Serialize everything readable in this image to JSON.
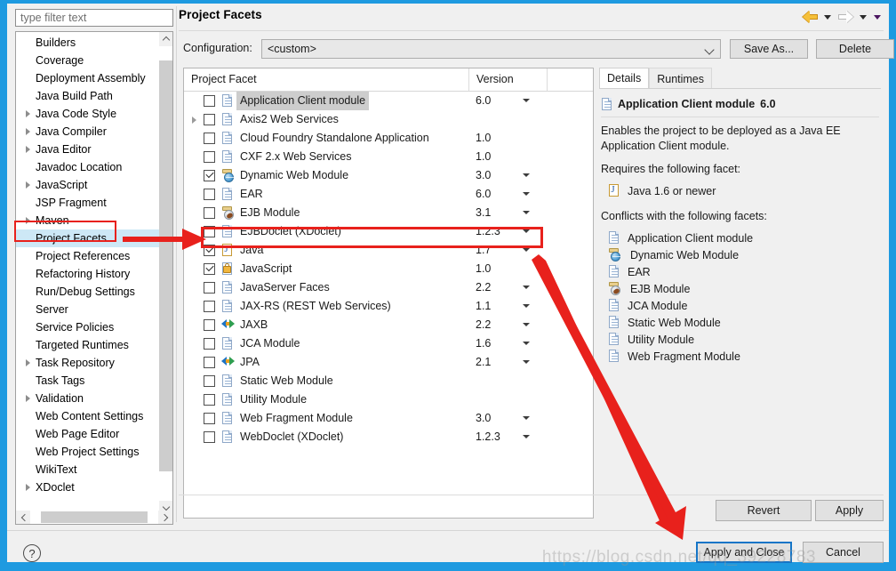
{
  "window": {
    "title": "Project Facets",
    "accent_color": "#1e9ae0"
  },
  "navbar": {
    "back_icon": "back-arrow-icon",
    "back_caret": "chevron-down-icon",
    "forward_icon": "forward-arrow-icon",
    "forward_caret": "chevron-down-icon",
    "menu_caret": "chevron-down-icon"
  },
  "sidebar": {
    "filter_placeholder": "type filter text",
    "items": [
      {
        "label": "Builders",
        "expandable": false,
        "selected": false
      },
      {
        "label": "Coverage",
        "expandable": false,
        "selected": false
      },
      {
        "label": "Deployment Assembly",
        "expandable": false,
        "selected": false
      },
      {
        "label": "Java Build Path",
        "expandable": false,
        "selected": false
      },
      {
        "label": "Java Code Style",
        "expandable": true,
        "selected": false
      },
      {
        "label": "Java Compiler",
        "expandable": true,
        "selected": false
      },
      {
        "label": "Java Editor",
        "expandable": true,
        "selected": false
      },
      {
        "label": "Javadoc Location",
        "expandable": false,
        "selected": false
      },
      {
        "label": "JavaScript",
        "expandable": true,
        "selected": false
      },
      {
        "label": "JSP Fragment",
        "expandable": false,
        "selected": false
      },
      {
        "label": "Maven",
        "expandable": true,
        "selected": false
      },
      {
        "label": "Project Facets",
        "expandable": false,
        "selected": true
      },
      {
        "label": "Project References",
        "expandable": false,
        "selected": false
      },
      {
        "label": "Refactoring History",
        "expandable": false,
        "selected": false
      },
      {
        "label": "Run/Debug Settings",
        "expandable": false,
        "selected": false
      },
      {
        "label": "Server",
        "expandable": false,
        "selected": false
      },
      {
        "label": "Service Policies",
        "expandable": false,
        "selected": false
      },
      {
        "label": "Targeted Runtimes",
        "expandable": false,
        "selected": false
      },
      {
        "label": "Task Repository",
        "expandable": true,
        "selected": false
      },
      {
        "label": "Task Tags",
        "expandable": false,
        "selected": false
      },
      {
        "label": "Validation",
        "expandable": true,
        "selected": false
      },
      {
        "label": "Web Content Settings",
        "expandable": false,
        "selected": false
      },
      {
        "label": "Web Page Editor",
        "expandable": false,
        "selected": false
      },
      {
        "label": "Web Project Settings",
        "expandable": false,
        "selected": false
      },
      {
        "label": "WikiText",
        "expandable": false,
        "selected": false
      },
      {
        "label": "XDoclet",
        "expandable": true,
        "selected": false
      }
    ]
  },
  "configuration": {
    "label": "Configuration:",
    "value": "<custom>",
    "save_as_label": "Save As...",
    "delete_label": "Delete"
  },
  "facet_table": {
    "columns": [
      "Project Facet",
      "Version",
      ""
    ],
    "rows": [
      {
        "name": "Application Client module",
        "icon": "doc-icon",
        "checked": false,
        "expandable": false,
        "version": "6.0",
        "has_dropdown": true,
        "highlighted": true
      },
      {
        "name": "Axis2 Web Services",
        "icon": "doc-icon",
        "checked": false,
        "expandable": true,
        "version": "",
        "has_dropdown": false,
        "highlighted": false
      },
      {
        "name": "Cloud Foundry Standalone Application",
        "icon": "doc-icon",
        "checked": false,
        "expandable": false,
        "version": "1.0",
        "has_dropdown": false,
        "highlighted": false
      },
      {
        "name": "CXF 2.x Web Services",
        "icon": "doc-icon",
        "checked": false,
        "expandable": false,
        "version": "1.0",
        "has_dropdown": false,
        "highlighted": false
      },
      {
        "name": "Dynamic Web Module",
        "icon": "web-module-icon",
        "checked": true,
        "expandable": false,
        "version": "3.0",
        "has_dropdown": true,
        "highlighted": false
      },
      {
        "name": "EAR",
        "icon": "doc-icon",
        "checked": false,
        "expandable": false,
        "version": "6.0",
        "has_dropdown": true,
        "highlighted": false
      },
      {
        "name": "EJB Module",
        "icon": "ejb-icon",
        "checked": false,
        "expandable": false,
        "version": "3.1",
        "has_dropdown": true,
        "highlighted": false
      },
      {
        "name": "EJBDoclet (XDoclet)",
        "icon": "doc-icon",
        "checked": false,
        "expandable": false,
        "version": "1.2.3",
        "has_dropdown": true,
        "highlighted": false
      },
      {
        "name": "Java",
        "icon": "java-icon",
        "checked": true,
        "expandable": false,
        "version": "1.7",
        "has_dropdown": true,
        "highlighted": false
      },
      {
        "name": "JavaScript",
        "icon": "javascript-icon",
        "checked": true,
        "expandable": false,
        "version": "1.0",
        "has_dropdown": false,
        "highlighted": false
      },
      {
        "name": "JavaServer Faces",
        "icon": "doc-icon",
        "checked": false,
        "expandable": false,
        "version": "2.2",
        "has_dropdown": true,
        "highlighted": false
      },
      {
        "name": "JAX-RS (REST Web Services)",
        "icon": "doc-icon",
        "checked": false,
        "expandable": false,
        "version": "1.1",
        "has_dropdown": true,
        "highlighted": false
      },
      {
        "name": "JAXB",
        "icon": "jaxb-icon",
        "checked": false,
        "expandable": false,
        "version": "2.2",
        "has_dropdown": true,
        "highlighted": false
      },
      {
        "name": "JCA Module",
        "icon": "doc-icon",
        "checked": false,
        "expandable": false,
        "version": "1.6",
        "has_dropdown": true,
        "highlighted": false
      },
      {
        "name": "JPA",
        "icon": "jaxb-icon",
        "checked": false,
        "expandable": false,
        "version": "2.1",
        "has_dropdown": true,
        "highlighted": false
      },
      {
        "name": "Static Web Module",
        "icon": "doc-icon",
        "checked": false,
        "expandable": false,
        "version": "",
        "has_dropdown": false,
        "highlighted": false
      },
      {
        "name": "Utility Module",
        "icon": "doc-icon",
        "checked": false,
        "expandable": false,
        "version": "",
        "has_dropdown": false,
        "highlighted": false
      },
      {
        "name": "Web Fragment Module",
        "icon": "doc-icon",
        "checked": false,
        "expandable": false,
        "version": "3.0",
        "has_dropdown": true,
        "highlighted": false
      },
      {
        "name": "WebDoclet (XDoclet)",
        "icon": "doc-icon",
        "checked": false,
        "expandable": false,
        "version": "1.2.3",
        "has_dropdown": true,
        "highlighted": false
      }
    ]
  },
  "details": {
    "tabs": [
      {
        "label": "Details",
        "active": true
      },
      {
        "label": "Runtimes",
        "active": false
      }
    ],
    "heading_name": "Application Client module",
    "heading_version": "6.0",
    "description": "Enables the project to be deployed as a Java EE Application Client module.",
    "requires_label": "Requires the following facet:",
    "requires": [
      {
        "label": "Java 1.6 or newer",
        "icon": "java-icon"
      }
    ],
    "conflicts_label": "Conflicts with the following facets:",
    "conflicts": [
      {
        "label": "Application Client module",
        "icon": "doc-icon"
      },
      {
        "label": "Dynamic Web Module",
        "icon": "web-module-icon"
      },
      {
        "label": "EAR",
        "icon": "doc-icon"
      },
      {
        "label": "EJB Module",
        "icon": "ejb-icon"
      },
      {
        "label": "JCA Module",
        "icon": "doc-icon"
      },
      {
        "label": "Static Web Module",
        "icon": "doc-icon"
      },
      {
        "label": "Utility Module",
        "icon": "doc-icon"
      },
      {
        "label": "Web Fragment Module",
        "icon": "doc-icon"
      }
    ]
  },
  "buttons": {
    "revert": "Revert",
    "apply": "Apply",
    "apply_and_close": "Apply and Close",
    "cancel": "Cancel",
    "help_icon": "help-icon",
    "help_glyph": "?"
  },
  "annotations": {
    "color": "#e8211c",
    "sidebar_box_target": "Project Facets",
    "facet_box_target": "Java",
    "watermark_text": "https://blog.csdn.net/qq_39228783"
  }
}
